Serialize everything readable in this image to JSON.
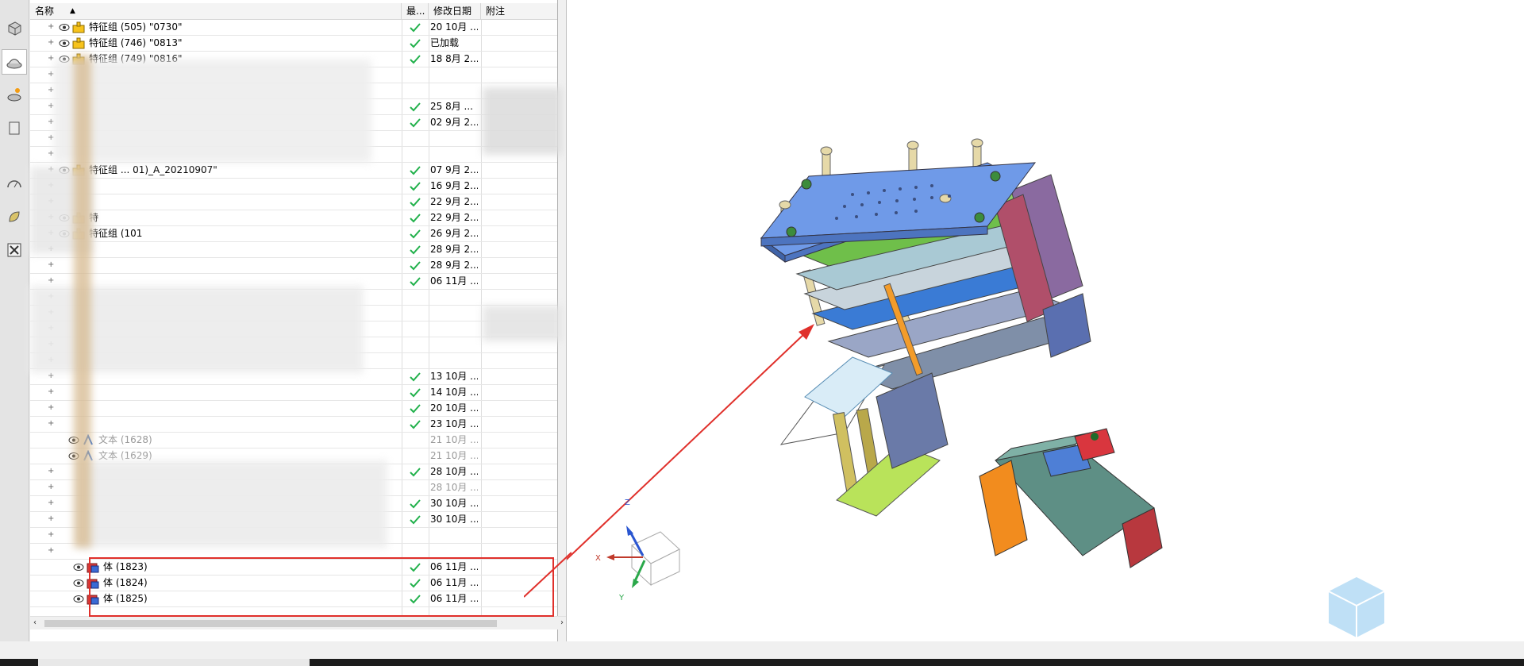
{
  "navigator": {
    "columns": {
      "name": "名称",
      "latest": "最...",
      "modified": "修改日期",
      "notes": "附注"
    },
    "rows": [
      {
        "name": "特征组 (505) \"0730\"",
        "date": "20 10月 ...",
        "check": true,
        "icon": "feature-group-icon"
      },
      {
        "name": "特征组 (746) \"0813\"",
        "date": "已加载",
        "check": true,
        "icon": "feature-group-icon"
      },
      {
        "name": "特征组 (749) \"0816\"",
        "date": "18 8月 2...",
        "check": true,
        "icon": "feature-group-icon"
      },
      {
        "name": "",
        "date": "",
        "check": false,
        "icon": ""
      },
      {
        "name": "",
        "date": "",
        "check": false,
        "icon": ""
      },
      {
        "name": "",
        "date": "25 8月 ...",
        "check": true,
        "icon": ""
      },
      {
        "name": "",
        "date": "02 9月 2...",
        "check": true,
        "icon": ""
      },
      {
        "name": "",
        "date": "",
        "check": false,
        "icon": ""
      },
      {
        "name": "",
        "date": "",
        "check": false,
        "icon": ""
      },
      {
        "name": "特征组 ... 01)_A_20210907\"",
        "date": "07 9月 2...",
        "check": true,
        "icon": "feature-group-icon"
      },
      {
        "name": "",
        "date": "16 9月 2...",
        "check": true,
        "icon": ""
      },
      {
        "name": "",
        "date": "22 9月 2...",
        "check": true,
        "icon": ""
      },
      {
        "name": "特",
        "date": "22 9月 2...",
        "check": true,
        "icon": "feature-group-icon"
      },
      {
        "name": "特征组 (101",
        "date": "26 9月 2...",
        "check": true,
        "icon": "feature-group-icon"
      },
      {
        "name": "",
        "date": "28 9月 2...",
        "check": true,
        "icon": ""
      },
      {
        "name": "",
        "date": "28 9月 2...",
        "check": true,
        "icon": ""
      },
      {
        "name": "",
        "date": "06 11月 ...",
        "check": true,
        "icon": ""
      },
      {
        "name": "",
        "date": "",
        "check": false,
        "icon": ""
      },
      {
        "name": "",
        "date": "",
        "check": false,
        "icon": ""
      },
      {
        "name": "",
        "date": "",
        "check": false,
        "icon": ""
      },
      {
        "name": "",
        "date": "",
        "check": false,
        "icon": ""
      },
      {
        "name": "",
        "date": "",
        "check": false,
        "icon": ""
      },
      {
        "name": "",
        "date": "13 10月 ...",
        "check": true,
        "icon": ""
      },
      {
        "name": "",
        "date": "14 10月 ...",
        "check": true,
        "icon": ""
      },
      {
        "name": "",
        "date": "20 10月 ...",
        "check": true,
        "icon": ""
      },
      {
        "name": "",
        "date": "23 10月 ...",
        "check": true,
        "icon": ""
      },
      {
        "name": "文本 (1628)",
        "date": "21 10月 ...",
        "check": false,
        "icon": "text-icon"
      },
      {
        "name": "文本 (1629)",
        "date": "21 10月 ...",
        "check": false,
        "icon": "text-icon"
      },
      {
        "name": "",
        "date": "28 10月 ...",
        "check": true,
        "icon": ""
      },
      {
        "name": "",
        "date": "28 10月 ...",
        "check": false,
        "icon": ""
      },
      {
        "name": "",
        "date": "30 10月 ...",
        "check": true,
        "icon": ""
      },
      {
        "name": "",
        "date": "30 10月 ...",
        "check": true,
        "icon": ""
      },
      {
        "name": "",
        "date": "",
        "check": false,
        "icon": ""
      },
      {
        "name": "",
        "date": "",
        "check": false,
        "icon": ""
      },
      {
        "name": "体 (1823)",
        "date": "06 11月 ...",
        "check": true,
        "icon": "body-icon"
      },
      {
        "name": "体 (1824)",
        "date": "06 11月 ...",
        "check": true,
        "icon": "body-icon"
      },
      {
        "name": "体 (1825)",
        "date": "06 11月 ...",
        "check": true,
        "icon": "body-icon"
      }
    ]
  },
  "triad": {
    "x_label": "X",
    "y_label": "Y",
    "z_label": "Z"
  },
  "colors": {
    "check": "#22b14c",
    "annotation_red": "#e0302b",
    "plate_blue": "#6f9ae8",
    "guide_post": "#e6d9a8"
  }
}
